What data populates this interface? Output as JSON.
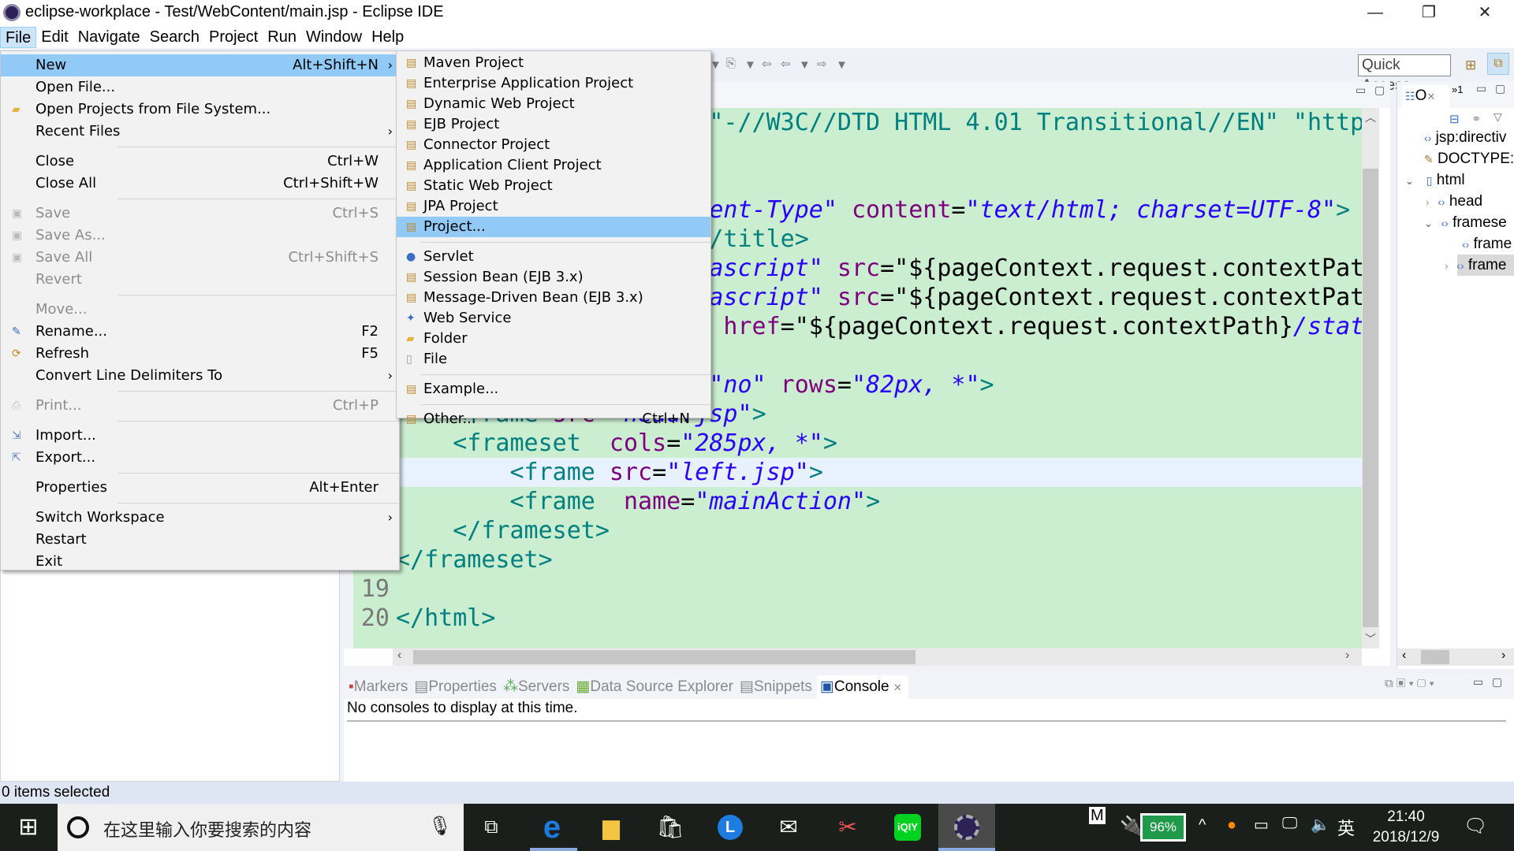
{
  "window": {
    "title": "eclipse-workplace - Test/WebContent/main.jsp - Eclipse IDE",
    "minimize": "—",
    "maximize": "❐",
    "close": "✕"
  },
  "menubar": [
    "File",
    "Edit",
    "Navigate",
    "Search",
    "Project",
    "Run",
    "Window",
    "Help"
  ],
  "toolbar": {
    "quick_access": "Quick Access"
  },
  "file_menu": [
    {
      "label": "New",
      "shortcut": "Alt+Shift+N",
      "submenu": true,
      "highlighted": true
    },
    {
      "label": "Open File..."
    },
    {
      "label": "Open Projects from File System...",
      "icon": "folder-icon"
    },
    {
      "label": "Recent Files",
      "submenu": true
    },
    {
      "sep": true
    },
    {
      "label": "Close",
      "shortcut": "Ctrl+W"
    },
    {
      "label": "Close All",
      "shortcut": "Ctrl+Shift+W"
    },
    {
      "sep": true
    },
    {
      "label": "Save",
      "shortcut": "Ctrl+S",
      "disabled": true,
      "icon": "save-icon"
    },
    {
      "label": "Save As...",
      "disabled": true,
      "icon": "save-as-icon"
    },
    {
      "label": "Save All",
      "shortcut": "Ctrl+Shift+S",
      "disabled": true,
      "icon": "save-all-icon"
    },
    {
      "label": "Revert",
      "disabled": true
    },
    {
      "sep": true
    },
    {
      "label": "Move...",
      "disabled": true
    },
    {
      "label": "Rename...",
      "shortcut": "F2",
      "icon": "rename-icon"
    },
    {
      "label": "Refresh",
      "shortcut": "F5",
      "icon": "refresh-icon"
    },
    {
      "label": "Convert Line Delimiters To",
      "submenu": true
    },
    {
      "sep": true
    },
    {
      "label": "Print...",
      "shortcut": "Ctrl+P",
      "disabled": true,
      "icon": "print-icon"
    },
    {
      "sep": true
    },
    {
      "label": "Import...",
      "icon": "import-icon"
    },
    {
      "label": "Export...",
      "icon": "export-icon"
    },
    {
      "sep": true
    },
    {
      "label": "Properties",
      "shortcut": "Alt+Enter"
    },
    {
      "sep": true
    },
    {
      "label": "Switch Workspace",
      "submenu": true
    },
    {
      "label": "Restart"
    },
    {
      "label": "Exit"
    }
  ],
  "new_submenu": [
    {
      "label": "Maven Project",
      "icon": "maven-project-icon"
    },
    {
      "label": "Enterprise Application Project",
      "icon": "ear-project-icon"
    },
    {
      "label": "Dynamic Web Project",
      "icon": "web-project-icon"
    },
    {
      "label": "EJB Project",
      "icon": "ejb-project-icon"
    },
    {
      "label": "Connector Project",
      "icon": "connector-project-icon"
    },
    {
      "label": "Application Client Project",
      "icon": "app-client-project-icon"
    },
    {
      "label": "Static Web Project",
      "icon": "static-web-project-icon"
    },
    {
      "label": "JPA Project",
      "icon": "jpa-project-icon"
    },
    {
      "label": "Project...",
      "icon": "project-icon",
      "highlighted": true
    },
    {
      "sep": true
    },
    {
      "label": "Servlet",
      "icon": "servlet-icon"
    },
    {
      "label": "Session Bean (EJB 3.x)",
      "icon": "session-bean-icon"
    },
    {
      "label": "Message-Driven Bean (EJB 3.x)",
      "icon": "mdb-icon"
    },
    {
      "label": "Web Service",
      "icon": "web-service-icon"
    },
    {
      "label": "Folder",
      "icon": "folder-icon"
    },
    {
      "label": "File",
      "icon": "file-icon"
    },
    {
      "sep": true
    },
    {
      "label": "Example...",
      "icon": "example-icon"
    },
    {
      "sep": true
    },
    {
      "label": "Other...",
      "shortcut": "Ctrl+N",
      "icon": "wizard-icon"
    }
  ],
  "code_colors": {
    "tag": "#008080",
    "attr": "#7f007f",
    "val": "#2a00ff",
    "plain": "#000000",
    "jsp": "#bf5f3f",
    "bg": "#cbedd0",
    "current": "#e8f2fe"
  },
  "code": [
    {
      "n": 2,
      "tokens": [
        {
          "t": "                        %>",
          "c": "jsp"
        }
      ]
    },
    {
      "n": 3,
      "tokens": [
        {
          "t": "                      \"-//W3C//DTD HTML 4.01 Transitional//EN\" \"http",
          "c": "tag"
        }
      ]
    },
    {
      "n": 6,
      "tokens": [
        {
          "t": "                      ent-Type\"",
          "c": "val",
          "i": true
        },
        {
          "t": " content",
          "c": "attr"
        },
        {
          "t": "=",
          "c": "plain"
        },
        {
          "t": "\"text/html; charset=UTF-8\"",
          "c": "val",
          "i": true
        },
        {
          "t": ">",
          "c": "tag"
        }
      ]
    },
    {
      "n": 7,
      "tokens": [
        {
          "t": "                      /title>",
          "c": "tag"
        }
      ]
    },
    {
      "n": 8,
      "tokens": [
        {
          "t": "                      ascript\"",
          "c": "val",
          "i": true
        },
        {
          "t": " src",
          "c": "attr"
        },
        {
          "t": "=\"${pageContext.request.contextPat",
          "c": "plain"
        }
      ]
    },
    {
      "n": 9,
      "tokens": [
        {
          "t": "                      ascript\"",
          "c": "val",
          "i": true
        },
        {
          "t": " src",
          "c": "attr"
        },
        {
          "t": "=\"${pageContext.request.contextPat",
          "c": "plain"
        }
      ]
    },
    {
      "n": 10,
      "tokens": [
        {
          "t": "                       href",
          "c": "attr"
        },
        {
          "t": "=\"${pageContext.request.contextPath}",
          "c": "plain"
        },
        {
          "t": "/stat",
          "c": "val",
          "i": true
        }
      ]
    },
    {
      "n": 12,
      "tokens": [
        {
          "t": "                      \"no\"",
          "c": "val",
          "i": true
        },
        {
          "t": " rows",
          "c": "attr"
        },
        {
          "t": "=",
          "c": "plain"
        },
        {
          "t": "\"82px, *\"",
          "c": "val",
          "i": true
        },
        {
          "t": ">",
          "c": "tag"
        }
      ]
    },
    {
      "n": 13,
      "tokens": [
        {
          "t": "    <frame",
          "c": "tag"
        },
        {
          "t": " src",
          "c": "attr"
        },
        {
          "t": "=",
          "c": "plain"
        },
        {
          "t": "\"head.jsp\"",
          "c": "val",
          "i": true
        },
        {
          "t": ">",
          "c": "tag"
        }
      ]
    },
    {
      "n": 14,
      "tokens": [
        {
          "t": "    <frameset",
          "c": "tag"
        },
        {
          "t": "  cols",
          "c": "attr"
        },
        {
          "t": "=",
          "c": "plain"
        },
        {
          "t": "\"285px, *\"",
          "c": "val",
          "i": true
        },
        {
          "t": ">",
          "c": "tag"
        }
      ]
    },
    {
      "n": 15,
      "current": true,
      "tokens": [
        {
          "t": "        <frame",
          "c": "tag"
        },
        {
          "t": " src",
          "c": "attr"
        },
        {
          "t": "=",
          "c": "plain"
        },
        {
          "t": "\"left.jsp\"",
          "c": "val",
          "i": true
        },
        {
          "t": ">",
          "c": "tag"
        }
      ]
    },
    {
      "n": 16,
      "tokens": [
        {
          "t": "        <frame",
          "c": "tag"
        },
        {
          "t": "  name",
          "c": "attr"
        },
        {
          "t": "=",
          "c": "plain"
        },
        {
          "t": "\"mainAction\"",
          "c": "val",
          "i": true
        },
        {
          "t": ">",
          "c": "tag"
        }
      ]
    },
    {
      "n": 17,
      "tokens": [
        {
          "t": "    </frameset>",
          "c": "tag"
        }
      ]
    },
    {
      "n": 18,
      "tokens": [
        {
          "t": "</frameset>",
          "c": "tag"
        }
      ]
    },
    {
      "n": 19,
      "tokens": []
    },
    {
      "n": 20,
      "tokens": [
        {
          "t": "</html>",
          "c": "tag"
        }
      ]
    }
  ],
  "line_numbers_visible": [
    "18",
    "19",
    "20"
  ],
  "outline": {
    "tab": "O",
    "overflow": "»1",
    "items": [
      "jsp:directiv",
      "DOCTYPE:h",
      "html",
      "head",
      "framese",
      "frame",
      "frame"
    ]
  },
  "bottom_tabs": [
    "Markers",
    "Properties",
    "Servers",
    "Data Source Explorer",
    "Snippets",
    "Console"
  ],
  "console": {
    "message": "No consoles to display at this time."
  },
  "status": {
    "text": "0 items selected"
  },
  "taskbar": {
    "search_placeholder": "在这里输入你要搜索的内容",
    "battery": "96%",
    "ime": "英",
    "ime_mode": "M",
    "time": "21:40",
    "date": "2018/12/9"
  }
}
